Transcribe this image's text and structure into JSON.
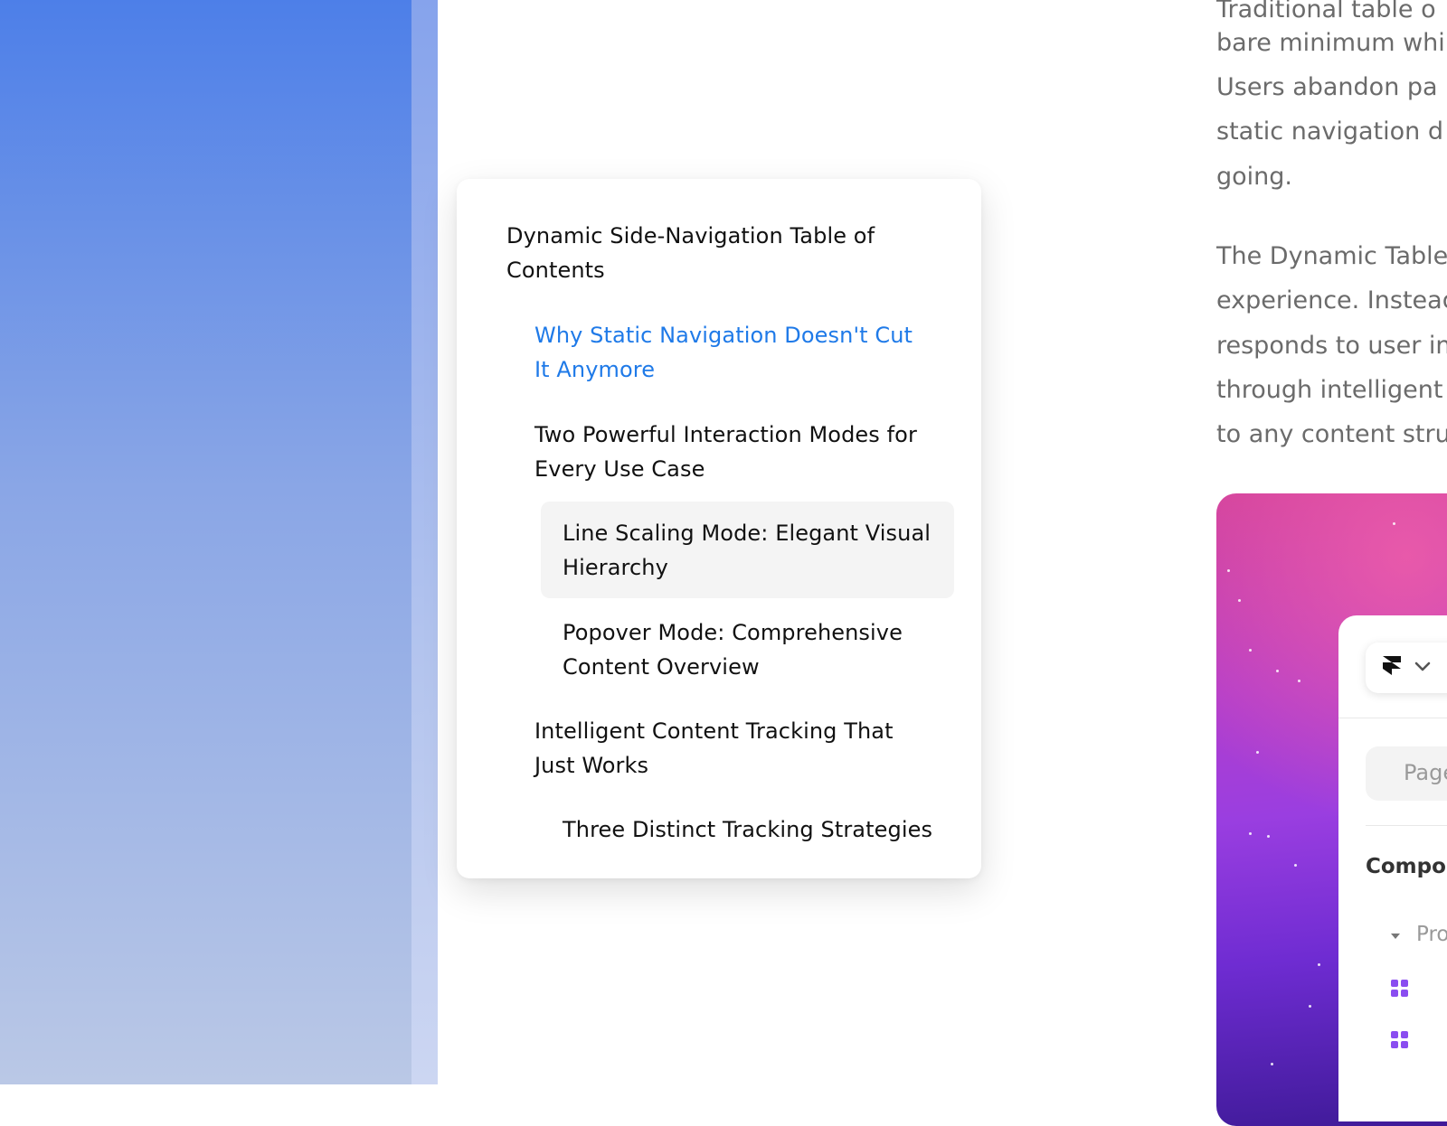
{
  "toc": {
    "items": [
      {
        "label": "Dynamic Side-Navigation Table of\nContents",
        "level": 0,
        "active": false
      },
      {
        "label": "Why Static Navigation Doesn't Cut\nIt Anymore",
        "level": 1,
        "active": true
      },
      {
        "label": "Two Powerful Interaction Modes for\nEvery Use Case",
        "level": 1,
        "active": false
      },
      {
        "label": "Line Scaling Mode: Elegant Visual\nHierarchy",
        "level": 2,
        "active": false,
        "hovered": true
      },
      {
        "label": "Popover Mode: Comprehensive\nContent Overview",
        "level": 2,
        "active": false
      },
      {
        "label": "Intelligent Content Tracking That\nJust Works",
        "level": 1,
        "active": false
      },
      {
        "label": "Three Distinct Tracking Strategies",
        "level": 2,
        "active": false
      }
    ]
  },
  "article": {
    "paragraph1": [
      "Traditional table o",
      "bare minimum whi",
      "Users abandon pa",
      "static navigation d",
      "going."
    ],
    "paragraph2": [
      "The Dynamic Table",
      "experience. Instead",
      "responds to user in",
      "through intelligent",
      "to any content stru"
    ]
  },
  "panel": {
    "search_placeholder": "Page",
    "section_label": "Compon",
    "tree_item": "Pro"
  },
  "colors": {
    "accent": "#1f7ae8",
    "body_text": "#6b6b6b",
    "component_icon": "#8a4df0"
  },
  "icons": [
    "framer-logo-icon",
    "chevron-down-icon",
    "caret-down-icon",
    "component-icon"
  ]
}
